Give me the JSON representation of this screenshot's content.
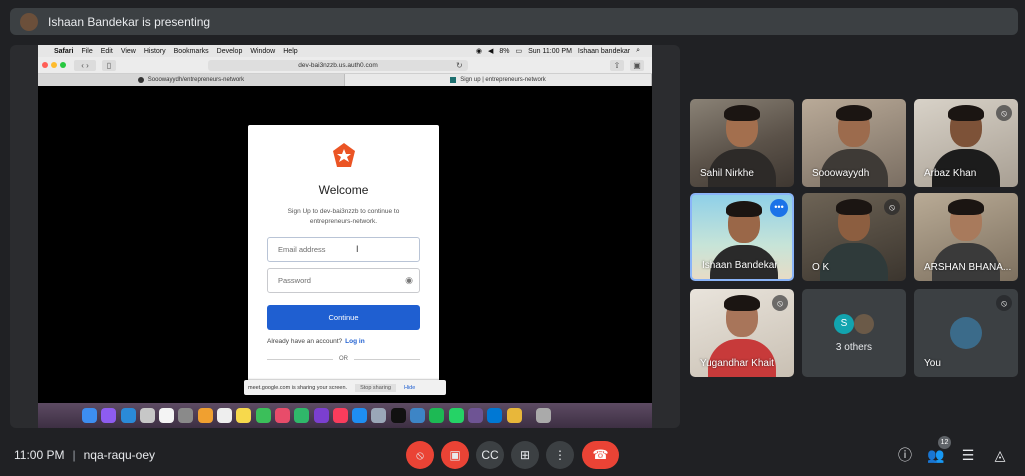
{
  "banner": {
    "text": "Ishaan Bandekar is presenting"
  },
  "mac": {
    "menu": [
      "Safari",
      "File",
      "Edit",
      "View",
      "History",
      "Bookmarks",
      "Develop",
      "Window",
      "Help"
    ],
    "battery": "8%",
    "time": "Sun 11:00 PM",
    "user": "Ishaan bandekar",
    "url": "dev-bai3nzzb.us.auth0.com",
    "tabs": [
      "Sooowayydh/entrepreneurs-network",
      "Sign up | entrepreneurs-network"
    ]
  },
  "auth": {
    "welcome": "Welcome",
    "subtitle": "Sign Up to dev-bai3nzzb to continue to entrepreneurs-network.",
    "email_placeholder": "Email address",
    "password_placeholder": "Password",
    "continue": "Continue",
    "already": "Already have an account?",
    "login": "Log in",
    "or": "OR"
  },
  "sharebar": {
    "text": "meet.google.com is sharing your screen.",
    "stop": "Stop sharing",
    "hide": "Hide"
  },
  "participants": [
    {
      "name": "Sahil Nirkhe"
    },
    {
      "name": "Sooowayydh"
    },
    {
      "name": "Arbaz Khan"
    },
    {
      "name": "Ishaan Bandekar"
    },
    {
      "name": "O K"
    },
    {
      "name": "ARSHAN BHANA..."
    },
    {
      "name": "Yugandhar Khait"
    }
  ],
  "others": {
    "label": "3 others",
    "initial": "S"
  },
  "you": {
    "label": "You"
  },
  "bottom": {
    "time": "11:00 PM",
    "meeting_code": "nqa-raqu-oey",
    "people_count": "12"
  },
  "colors": {
    "accent_blue": "#1a73e8",
    "end_red": "#ea4335",
    "auth_button": "#1f5fd1"
  }
}
